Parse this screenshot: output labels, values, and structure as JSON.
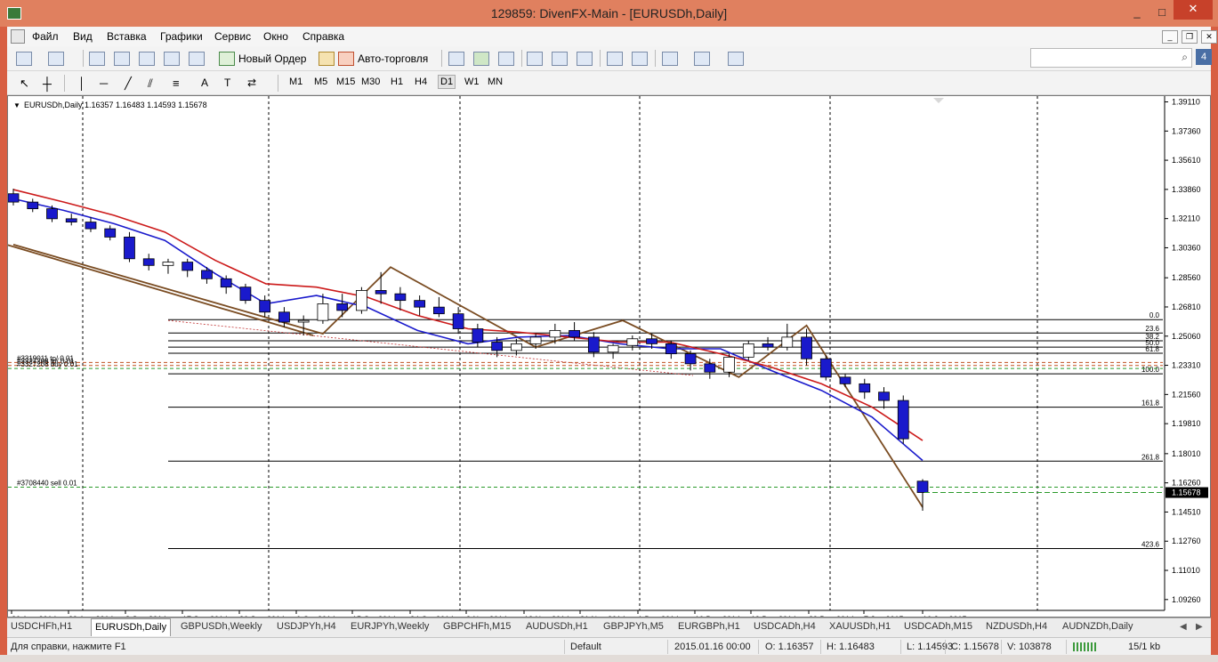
{
  "window": {
    "title": "129859: DivenFX-Main - [EURUSDh,Daily]",
    "minimize": "_",
    "maximize": "□",
    "close": "✕"
  },
  "menu": [
    "Файл",
    "Вид",
    "Вставка",
    "Графики",
    "Сервис",
    "Окно",
    "Справка"
  ],
  "toolbar": {
    "new_order": "Новый Ордер",
    "auto_trading": "Авто-торговля",
    "search_placeholder": "",
    "notifications": "4"
  },
  "timeframes": [
    {
      "label": "M1",
      "active": false
    },
    {
      "label": "M5",
      "active": false
    },
    {
      "label": "M15",
      "active": false
    },
    {
      "label": "M30",
      "active": false
    },
    {
      "label": "H1",
      "active": false
    },
    {
      "label": "H4",
      "active": false
    },
    {
      "label": "D1",
      "active": true
    },
    {
      "label": "W1",
      "active": false
    },
    {
      "label": "MN",
      "active": false
    }
  ],
  "tabs": [
    "USDCHFh,H1",
    "EURUSDh,Daily",
    "GBPUSDh,Weekly",
    "USDJPYh,H4",
    "EURJPYh,Weekly",
    "GBPCHFh,M15",
    "AUDUSDh,H1",
    "GBPJPYh,M5",
    "EURGBPh,H1",
    "USDCADh,H4",
    "XAUUSDh,H1",
    "USDCADh,M15",
    "NZDUSDh,H4",
    "AUDNZDh,Daily"
  ],
  "active_tab": 1,
  "status": {
    "help": "Для справки, нажмите F1",
    "profile": "Default",
    "datetime": "2015.01.16 00:00",
    "open": "O: 1.16357",
    "high": "H: 1.16483",
    "low": "L: 1.14593",
    "close": "C: 1.15678",
    "volume": "V: 103878",
    "traffic": "15/1 kb"
  },
  "chart_data": {
    "type": "candlestick",
    "symbol_info": "EURUSDh,Daily  1.16357 1.16483 1.14593 1.15678",
    "ylim": [
      1.0925,
      1.3935
    ],
    "y_ticks": [
      "1.39110",
      "1.37360",
      "1.35610",
      "1.33860",
      "1.32110",
      "1.30360",
      "1.28560",
      "1.26810",
      "1.25060",
      "1.23310",
      "1.21560",
      "1.19810",
      "1.18010",
      "1.16260",
      "1.14510",
      "1.12760",
      "1.11010",
      "1.09260"
    ],
    "current_price": "1.15678",
    "x_ticks": [
      "20 Aug 2014",
      "29 Aug 2014",
      "8 Sep 2014",
      "17 Sep 2014",
      "26 Sep 2014",
      "6 Oct 2014",
      "15 Oct 2014",
      "24 Oct 2014",
      "3 Nov 2014",
      "12 Nov 2014",
      "21 Nov 2014",
      "1 Dec 2014",
      "10 Dec 2014",
      "19 Dec 2014",
      "29 Dec 2014",
      "7 Jan 2015",
      "16 Jan 2015"
    ],
    "fibonacci": [
      {
        "label": "0.0",
        "price": 1.2605
      },
      {
        "label": "23.6",
        "price": 1.2525
      },
      {
        "label": "38.2",
        "price": 1.2478
      },
      {
        "label": "50.0",
        "price": 1.244
      },
      {
        "label": "61.8",
        "price": 1.2403
      },
      {
        "label": "100.0",
        "price": 1.228
      },
      {
        "label": "161.8",
        "price": 1.208
      },
      {
        "label": "261.8",
        "price": 1.1756
      },
      {
        "label": "423.6",
        "price": 1.1232
      }
    ],
    "orders": [
      {
        "label": "#3319011 tp/ 0.01",
        "price": 1.2348
      },
      {
        "label": "#3327208 tp/ 0.01",
        "price": 1.233
      },
      {
        "label": "#3327208 buy 0.01",
        "price": 1.2312
      },
      {
        "label": "#3708440 sell 0.01",
        "price": 1.16
      }
    ],
    "moving_averages": [
      {
        "name": "fast",
        "color": "#1a1acc",
        "values": [
          1.333,
          1.326,
          1.318,
          1.308,
          1.288,
          1.27,
          1.275,
          1.268,
          1.254,
          1.246,
          1.25,
          1.251,
          1.246,
          1.243,
          1.243,
          1.23,
          1.218,
          1.202,
          1.176
        ]
      },
      {
        "name": "slow",
        "color": "#cc1a1a",
        "values": [
          1.3385,
          1.331,
          1.323,
          1.313,
          1.296,
          1.282,
          1.28,
          1.274,
          1.263,
          1.255,
          1.253,
          1.25,
          1.247,
          1.247,
          1.24,
          1.232,
          1.222,
          1.208,
          1.188
        ]
      }
    ],
    "trendlines": [
      {
        "color": "#7a4c22",
        "points": [
          [
            0,
            1.3055
          ],
          [
            16,
            1.252
          ],
          [
            19.5,
            1.292
          ],
          [
            27,
            1.244
          ],
          [
            31.5,
            1.26
          ],
          [
            37.5,
            1.226
          ],
          [
            41,
            1.257
          ],
          [
            47,
            1.148
          ]
        ]
      },
      {
        "color": "#7a4c22",
        "points": [
          [
            -0.5,
            1.306
          ],
          [
            15.5,
            1.251
          ]
        ]
      }
    ],
    "candles": [
      [
        1.336,
        1.339,
        1.329,
        1.331
      ],
      [
        1.331,
        1.333,
        1.325,
        1.327
      ],
      [
        1.327,
        1.329,
        1.319,
        1.321
      ],
      [
        1.321,
        1.324,
        1.317,
        1.319
      ],
      [
        1.319,
        1.322,
        1.313,
        1.315
      ],
      [
        1.315,
        1.317,
        1.308,
        1.31
      ],
      [
        1.31,
        1.313,
        1.295,
        1.297
      ],
      [
        1.297,
        1.3,
        1.29,
        1.293
      ],
      [
        1.293,
        1.297,
        1.288,
        1.295
      ],
      [
        1.295,
        1.297,
        1.286,
        1.29
      ],
      [
        1.29,
        1.292,
        1.282,
        1.285
      ],
      [
        1.285,
        1.287,
        1.276,
        1.28
      ],
      [
        1.28,
        1.282,
        1.27,
        1.272
      ],
      [
        1.272,
        1.275,
        1.262,
        1.265
      ],
      [
        1.265,
        1.268,
        1.256,
        1.259
      ],
      [
        1.259,
        1.263,
        1.251,
        1.26
      ],
      [
        1.26,
        1.276,
        1.258,
        1.27
      ],
      [
        1.27,
        1.276,
        1.262,
        1.266
      ],
      [
        1.266,
        1.28,
        1.264,
        1.278
      ],
      [
        1.278,
        1.289,
        1.27,
        1.276
      ],
      [
        1.276,
        1.28,
        1.266,
        1.272
      ],
      [
        1.272,
        1.275,
        1.263,
        1.268
      ],
      [
        1.268,
        1.274,
        1.262,
        1.264
      ],
      [
        1.264,
        1.268,
        1.252,
        1.255
      ],
      [
        1.255,
        1.258,
        1.244,
        1.247
      ],
      [
        1.247,
        1.25,
        1.238,
        1.242
      ],
      [
        1.242,
        1.249,
        1.239,
        1.246
      ],
      [
        1.246,
        1.252,
        1.243,
        1.25
      ],
      [
        1.25,
        1.258,
        1.246,
        1.254
      ],
      [
        1.254,
        1.259,
        1.248,
        1.25
      ],
      [
        1.25,
        1.253,
        1.238,
        1.241
      ],
      [
        1.241,
        1.246,
        1.237,
        1.245
      ],
      [
        1.245,
        1.251,
        1.242,
        1.249
      ],
      [
        1.249,
        1.252,
        1.243,
        1.246
      ],
      [
        1.246,
        1.248,
        1.237,
        1.24
      ],
      [
        1.24,
        1.242,
        1.23,
        1.234
      ],
      [
        1.234,
        1.237,
        1.225,
        1.229
      ],
      [
        1.229,
        1.24,
        1.226,
        1.238
      ],
      [
        1.238,
        1.248,
        1.236,
        1.246
      ],
      [
        1.246,
        1.25,
        1.242,
        1.244
      ],
      [
        1.244,
        1.258,
        1.242,
        1.25
      ],
      [
        1.25,
        1.255,
        1.233,
        1.237
      ],
      [
        1.237,
        1.239,
        1.224,
        1.226
      ],
      [
        1.226,
        1.228,
        1.22,
        1.222
      ],
      [
        1.222,
        1.225,
        1.213,
        1.217
      ],
      [
        1.217,
        1.22,
        1.207,
        1.212
      ],
      [
        1.212,
        1.215,
        1.186,
        1.189
      ],
      [
        1.1636,
        1.1648,
        1.1459,
        1.1568
      ]
    ]
  }
}
